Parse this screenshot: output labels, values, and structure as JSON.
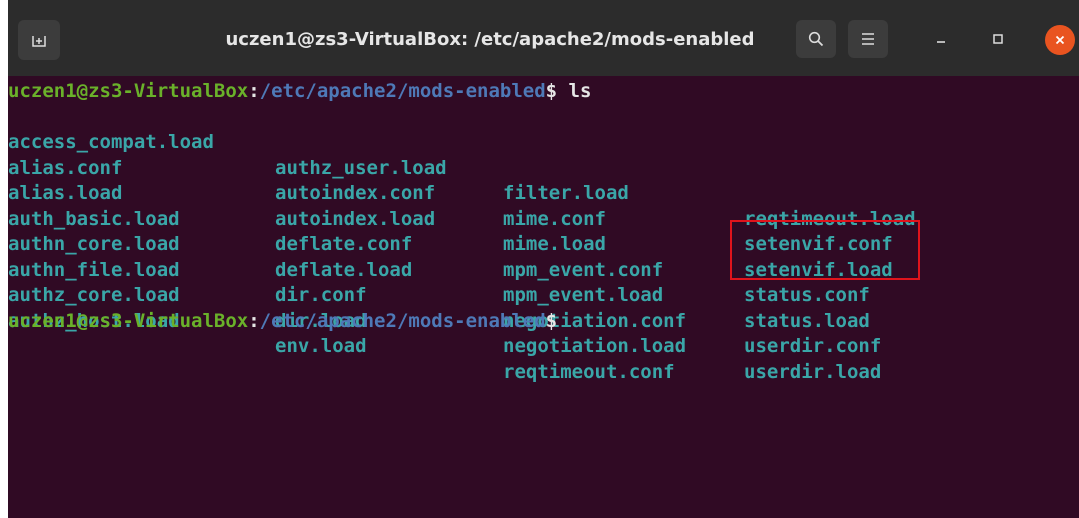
{
  "window": {
    "title": "uczen1@zs3-VirtualBox: /etc/apache2/mods-enabled"
  },
  "buttons": {
    "new_tab": "new-tab-icon",
    "search": "search-icon",
    "menu": "hamburger-menu-icon",
    "minimize": "minimize-icon",
    "maximize": "maximize-icon",
    "close": "close-icon"
  },
  "terminal": {
    "prompt": {
      "user_host": "uczen1@zs3-VirtualBox",
      "colon": ":",
      "path": "/etc/apache2/mods-enabled",
      "dollar": "$"
    },
    "command": " ls",
    "listing": [
      [
        "access_compat.load",
        "authz_user.load",
        "filter.load",
        "reqtimeout.load"
      ],
      [
        "alias.conf",
        "autoindex.conf",
        "mime.conf",
        "setenvif.conf"
      ],
      [
        "alias.load",
        "autoindex.load",
        "mime.load",
        "setenvif.load"
      ],
      [
        "auth_basic.load",
        "deflate.conf",
        "mpm_event.conf",
        "status.conf"
      ],
      [
        "authn_core.load",
        "deflate.load",
        "mpm_event.load",
        "status.load"
      ],
      [
        "authn_file.load",
        "dir.conf",
        "negotiation.conf",
        "userdir.conf"
      ],
      [
        "authz_core.load",
        "dir.load",
        "negotiation.load",
        "userdir.load"
      ],
      [
        "authz_host.load",
        "env.load",
        "reqtimeout.conf",
        ""
      ]
    ],
    "highlighted": [
      "userdir.conf",
      "userdir.load"
    ]
  },
  "colors": {
    "background": "#300a24",
    "titlebar": "#2c2c2c",
    "prompt_user": "#6ab12a",
    "prompt_path": "#4e79b7",
    "listing": "#3aa6a8",
    "highlight": "#e0141c",
    "close": "#e95420"
  }
}
